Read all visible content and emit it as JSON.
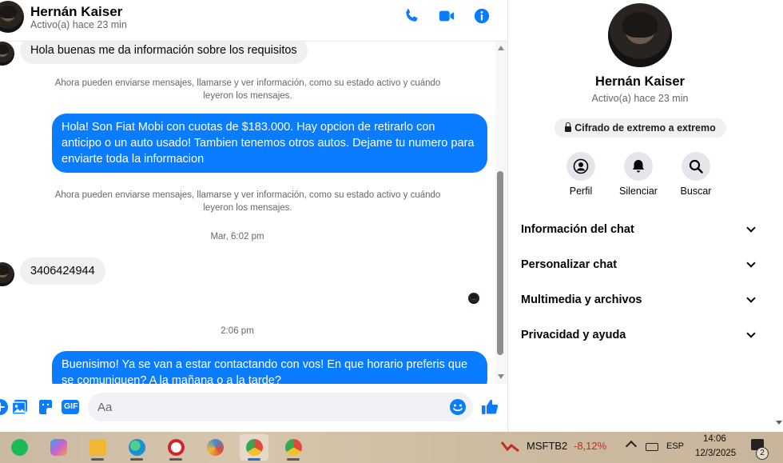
{
  "header": {
    "name": "Hernán Kaiser",
    "status": "Activo(a) hace 23 min",
    "icons": [
      "phone-icon",
      "video-icon",
      "info-icon"
    ],
    "accent": "#0a7cff"
  },
  "messages": {
    "incoming_1": "Hola buenas me da información sobre los requisitos",
    "system_note_1": "Ahora pueden enviarse mensajes, llamarse y ver información, como su estado activo y cuándo leyeron los mensajes.",
    "outgoing_1": "Hola! Son Fiat Mobi con cuotas de $183.000. Hay opcion de retirarlo con anticipo o un auto usado! Tambien tenemos otros autos. Dejame tu numero para enviarte toda la informacion",
    "system_note_2": "Ahora pueden enviarse mensajes, llamarse y ver información, como su estado activo y cuándo leyeron los mensajes.",
    "timestamp_1": "Mar, 6:02 pm",
    "incoming_2": "3406424944",
    "timestamp_2": "2:06 pm",
    "outgoing_2": "Buenisimo! Ya se van a estar contactando con vos! En que horario preferis que se comuniquen? A la mañana o a la tarde?"
  },
  "composer": {
    "placeholder": "Aa",
    "icons": [
      "add-icon",
      "photo-icon",
      "sticker-icon",
      "gif-icon",
      "emoji-icon",
      "like-icon"
    ],
    "gif_label": "GIF"
  },
  "info_panel": {
    "name": "Hernán Kaiser",
    "status": "Activo(a) hace 23 min",
    "encryption_badge": "Cifrado de extremo a extremo",
    "actions": [
      {
        "label": "Perfil",
        "icon": "profile-icon"
      },
      {
        "label": "Silenciar",
        "icon": "bell-icon"
      },
      {
        "label": "Buscar",
        "icon": "search-icon"
      }
    ],
    "sections": [
      "Información del chat",
      "Personalizar chat",
      "Multimedia y archivos",
      "Privacidad y ayuda"
    ]
  },
  "taskbar": {
    "apps": [
      {
        "name": "spotify",
        "color": "#1db954"
      },
      {
        "name": "copilot",
        "color": "#c85fd6"
      },
      {
        "name": "file-explorer",
        "color": "#f2b632"
      },
      {
        "name": "edge",
        "color": "#1a8fd6"
      },
      {
        "name": "opera",
        "color": "#d6202c"
      },
      {
        "name": "app-pinwheel",
        "color": "#3a8fd8"
      },
      {
        "name": "chrome",
        "color": "#e04a3a"
      },
      {
        "name": "chrome-profile",
        "color": "#e9a23b"
      }
    ],
    "stock_name": "MSFTB2",
    "stock_change": "-8,12%",
    "language": "ESP",
    "time": "14:06",
    "date": "12/3/2025",
    "notification_count": "2"
  }
}
